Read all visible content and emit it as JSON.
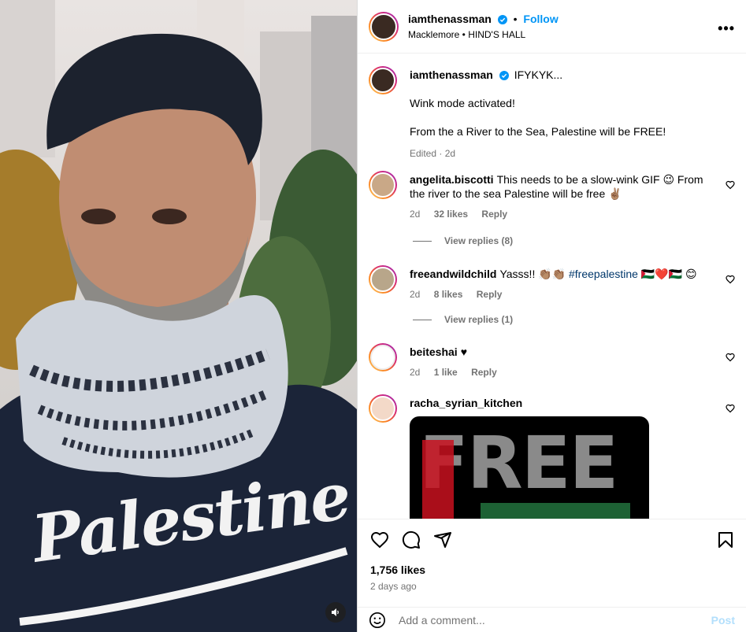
{
  "post": {
    "author": "iamthenassman",
    "follow_label": "Follow",
    "dot": "•",
    "audio": "Macklemore • HIND'S HALL",
    "more": "•••",
    "shirt_text": "Palestine",
    "caption_head": "IFYKYK...",
    "caption_line1": "Wink mode activated!",
    "caption_line2": "From the a River to the Sea, Palestine will be FREE!",
    "caption_meta": "Edited · 2d"
  },
  "comments": [
    {
      "user": "angelita.biscotti",
      "text": "This needs to be a slow-wink GIF 😉 From the river to the sea Palestine will be free ✌🏽",
      "time": "2d",
      "likes": "32 likes",
      "reply": "Reply",
      "view_replies": "View replies (8)"
    },
    {
      "user": "freeandwildchild",
      "text_pre": "Yasss!! 👏🏽👏🏽",
      "hashtag": "#freepalestine",
      "text_post": "🇵🇸❤️🇵🇸 😊",
      "time": "2d",
      "likes": "8 likes",
      "reply": "Reply",
      "view_replies": "View replies (1)"
    },
    {
      "user": "beiteshai",
      "text": "♥",
      "time": "2d",
      "likes": "1 like",
      "reply": "Reply"
    },
    {
      "user": "racha_syrian_kitchen",
      "gif_text": "FREE"
    }
  ],
  "stats": {
    "likes": "1,756 likes",
    "ago": "2 days ago"
  },
  "composer": {
    "placeholder": "Add a comment...",
    "post_label": "Post"
  }
}
